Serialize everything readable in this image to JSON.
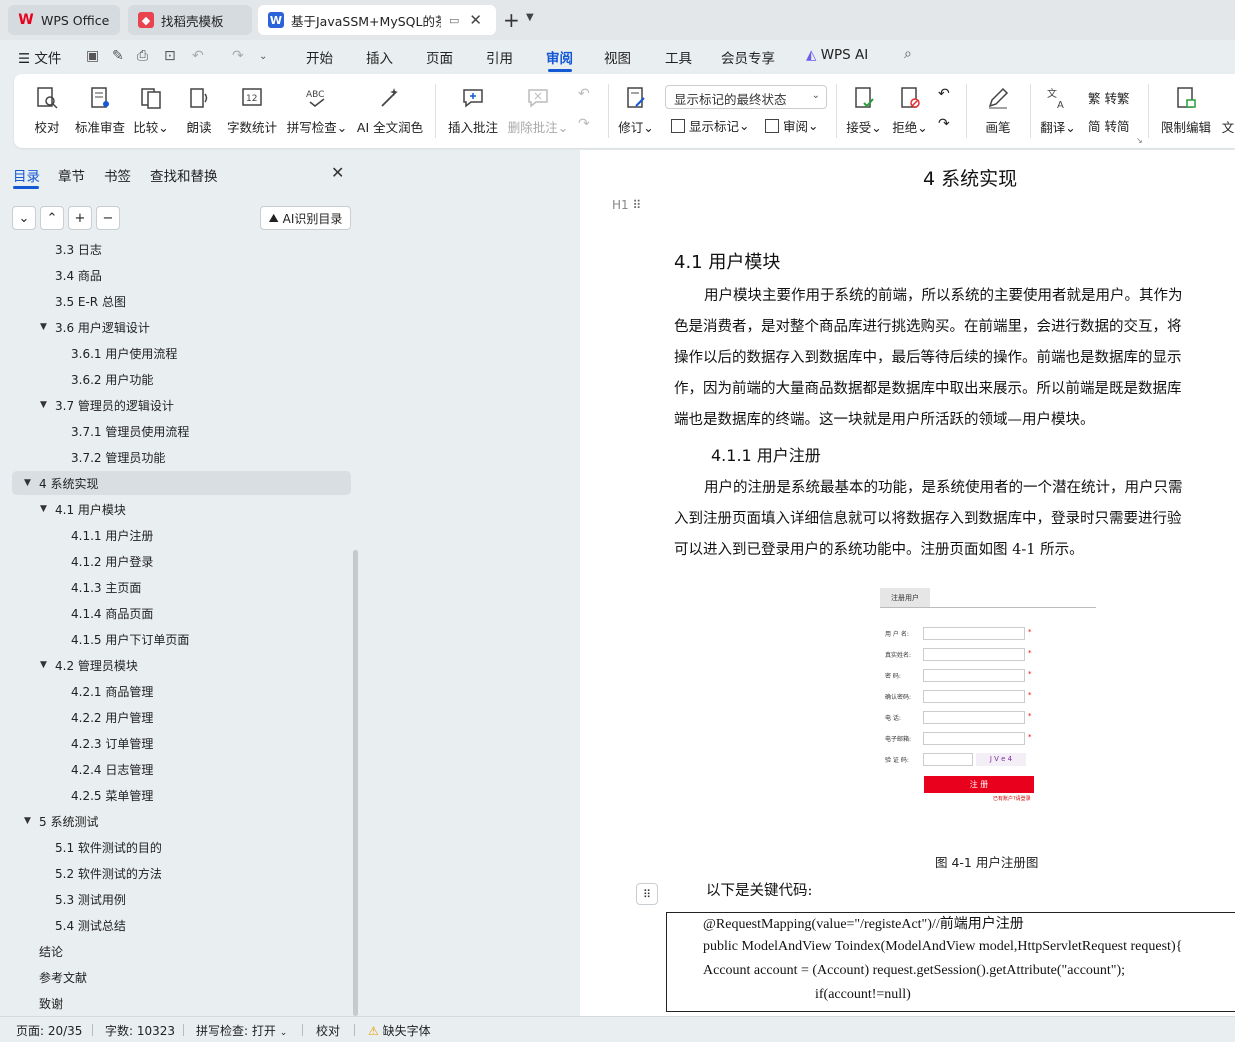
{
  "tabs": [
    {
      "label": "WPS Office",
      "icon": "wps-logo-icon"
    },
    {
      "label": "找稻壳模板",
      "icon": "daoke-icon"
    },
    {
      "label": "基于JavaSSM+MySQL的茶叶",
      "icon": "word-doc-icon"
    }
  ],
  "menu": {
    "file": "文件",
    "items": [
      "开始",
      "插入",
      "页面",
      "引用",
      "审阅",
      "视图",
      "工具",
      "会员专享"
    ],
    "active": "审阅",
    "wps_ai": "WPS AI"
  },
  "ribbon": {
    "proofread": "校对",
    "std_review": "标准审查",
    "compare": "比较",
    "read_aloud": "朗读",
    "word_count": "字数统计",
    "spell_check": "拼写检查",
    "ai_polish": "AI 全文润色",
    "insert_comment": "插入批注",
    "delete_comment": "删除批注",
    "revise": "修订",
    "markup_mode": "显示标记的最终状态",
    "show_markup": "显示标记",
    "review": "审阅",
    "accept": "接受",
    "reject": "拒绝",
    "pen": "画笔",
    "translate": "翻译",
    "to_traditional": "转繁",
    "to_simplified": "转简",
    "restrict_edit": "限制编辑",
    "doc_cut": "文"
  },
  "panel": {
    "tabs": [
      "目录",
      "章节",
      "书签",
      "查找和替换"
    ],
    "ai_toc": "AI识别目录",
    "toc": [
      {
        "label": "3.3 日志",
        "level": 2
      },
      {
        "label": "3.4 商品",
        "level": 2
      },
      {
        "label": "3.5 E-R 总图",
        "level": 2
      },
      {
        "label": "3.6 用户逻辑设计",
        "level": 2,
        "expanded": true
      },
      {
        "label": "3.6.1 用户使用流程",
        "level": 3
      },
      {
        "label": "3.6.2 用户功能",
        "level": 3
      },
      {
        "label": "3.7 管理员的逻辑设计",
        "level": 2,
        "expanded": true
      },
      {
        "label": "3.7.1 管理员使用流程",
        "level": 3
      },
      {
        "label": "3.7.2 管理员功能",
        "level": 3
      },
      {
        "label": "4 系统实现",
        "level": 1,
        "expanded": true,
        "selected": true
      },
      {
        "label": "4.1 用户模块",
        "level": 2,
        "expanded": true
      },
      {
        "label": "4.1.1 用户注册",
        "level": 3
      },
      {
        "label": "4.1.2 用户登录",
        "level": 3
      },
      {
        "label": "4.1.3 主页面",
        "level": 3
      },
      {
        "label": "4.1.4 商品页面",
        "level": 3
      },
      {
        "label": "4.1.5 用户下订单页面",
        "level": 3
      },
      {
        "label": "4.2 管理员模块",
        "level": 2,
        "expanded": true
      },
      {
        "label": "4.2.1 商品管理",
        "level": 3
      },
      {
        "label": "4.2.2 用户管理",
        "level": 3
      },
      {
        "label": "4.2.3 订单管理",
        "level": 3
      },
      {
        "label": "4.2.4 日志管理",
        "level": 3
      },
      {
        "label": "4.2.5 菜单管理",
        "level": 3
      },
      {
        "label": "5 系统测试",
        "level": 1,
        "expanded": true
      },
      {
        "label": "5.1 软件测试的目的",
        "level": 2
      },
      {
        "label": "5.2 软件测试的方法",
        "level": 2
      },
      {
        "label": "5.3 测试用例",
        "level": 2
      },
      {
        "label": "5.4 测试总结",
        "level": 2
      },
      {
        "label": "结论",
        "level": 1
      },
      {
        "label": "参考文献",
        "level": 1
      },
      {
        "label": "致谢",
        "level": 1
      }
    ]
  },
  "doc": {
    "h1": "4  系统实现",
    "heading_marker": "H1",
    "h2": "4.1  用户模块",
    "para1": [
      "用户模块主要作用于系统的前端，所以系统的主要使用者就是用户。其作为",
      "色是消费者，是对整个商品库进行挑选购买。在前端里，会进行数据的交互，将",
      "操作以后的数据存入到数据库中，最后等待后续的操作。前端也是数据库的显示",
      "作，因为前端的大量商品数据都是数据库中取出来展示。所以前端是既是数据库",
      "端也是数据库的终端。这一块就是用户所活跃的领域—用户模块。"
    ],
    "h3": "4.1.1  用户注册",
    "para2": [
      "用户的注册是系统最基本的功能，是系统使用者的一个潜在统计，用户只需",
      "入到注册页面填入详细信息就可以将数据存入到数据库中，登录时只需要进行验",
      "可以进入到已登录用户的系统功能中。注册页面如图 4-1 所示。"
    ],
    "figure": {
      "tab": "注册用户",
      "fields": [
        "用 户 名:",
        "真实姓名:",
        "密    码:",
        "确认密码:",
        "电    话:",
        "电子邮箱:",
        "验 证 码:"
      ],
      "captcha": "J V e 4",
      "button": "注  册",
      "link": "已有账户?请登录"
    },
    "caption": "图 4-1 用户注册图",
    "keycode_intro": "以下是关键代码:",
    "code": [
      "@RequestMapping(value=\"/registeAct\")//前端用户注册",
      "public ModelAndView Toindex(ModelAndView model,HttpServletRequest request){",
      "Account account = (Account) request.getSession().getAttribute(\"account\");",
      "if(account!=null)"
    ]
  },
  "status": {
    "page": "页面: 20/35",
    "words": "字数: 10323",
    "spell": "拼写检查: 打开",
    "proof": "校对",
    "missing_font": "缺失字体"
  },
  "colors": {
    "accent": "#1558d6",
    "wps_red": "#e8001c"
  }
}
